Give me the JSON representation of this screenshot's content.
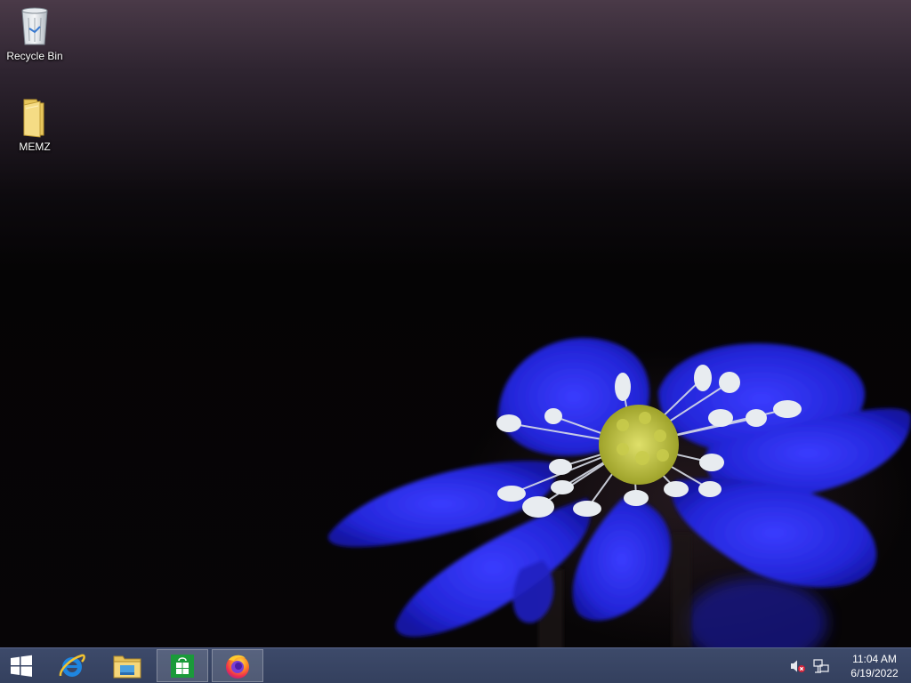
{
  "desktop": {
    "icons": [
      {
        "label": "Recycle Bin",
        "icon": "recycle-bin-icon"
      },
      {
        "label": "MEMZ",
        "icon": "folder-icon"
      }
    ]
  },
  "taskbar": {
    "start": {
      "icon": "windows-logo-icon"
    },
    "pinned": [
      {
        "app": "Internet Explorer",
        "icon": "internet-explorer-icon"
      },
      {
        "app": "File Explorer",
        "icon": "file-explorer-icon"
      },
      {
        "app": "Store",
        "icon": "store-icon"
      },
      {
        "app": "Firefox",
        "icon": "firefox-icon"
      }
    ],
    "tray": {
      "icons": [
        "volume-muted-icon",
        "network-icon"
      ],
      "time": "11:04 AM",
      "date": "6/19/2022"
    }
  },
  "colors": {
    "taskbar": "#3d4a6a",
    "wallpaper_flower": "#2a2ee0",
    "store_green": "#1a9a3a"
  }
}
